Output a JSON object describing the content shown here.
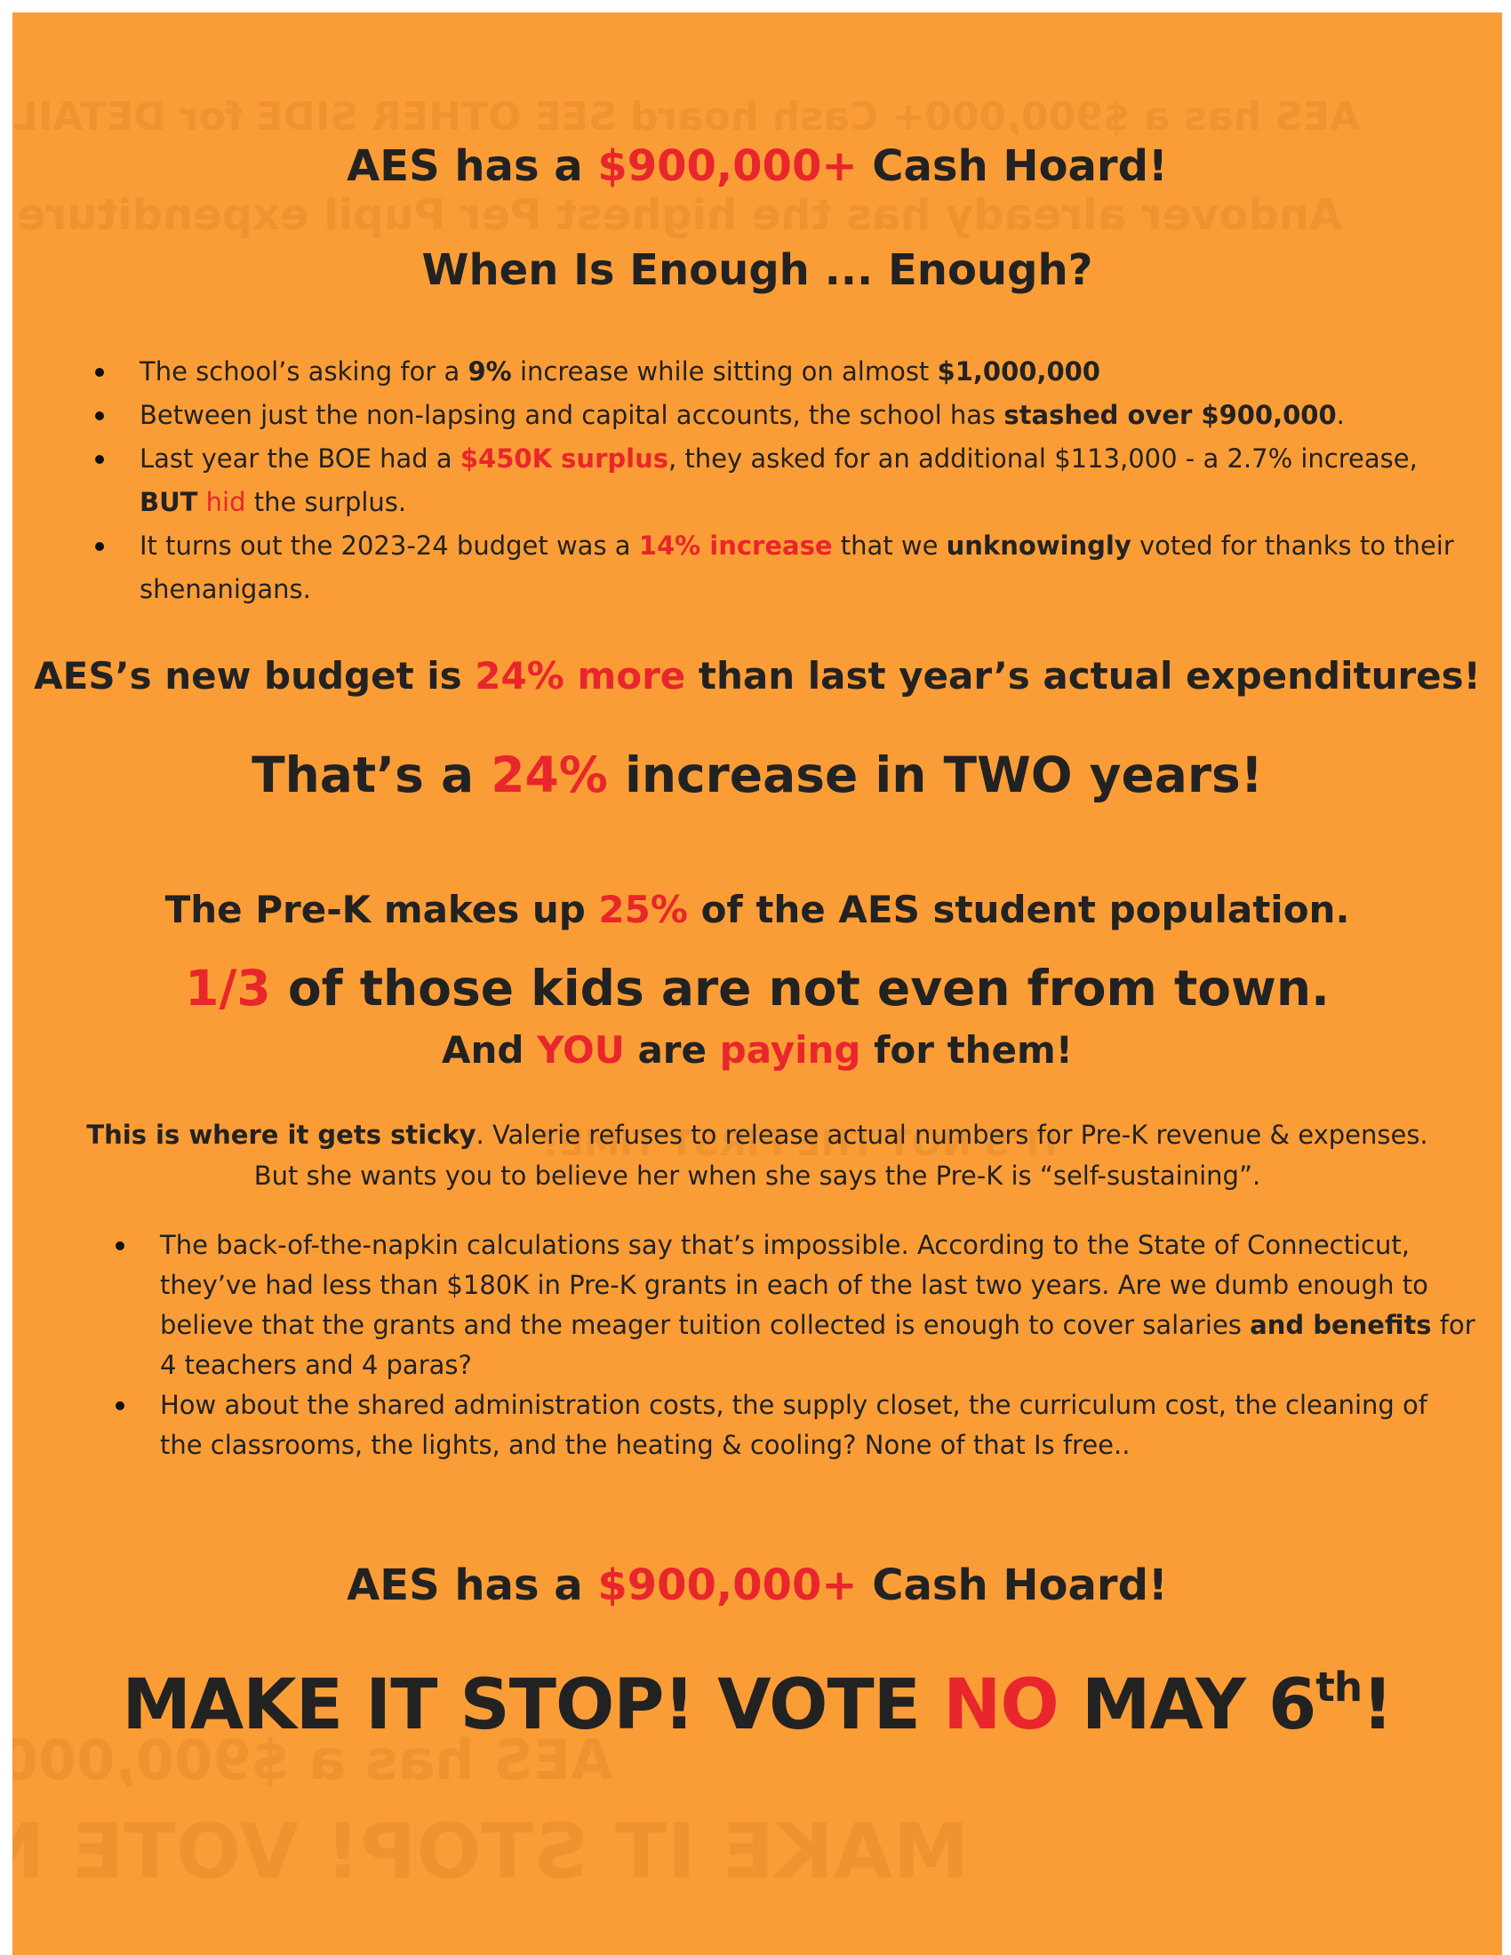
{
  "header": {
    "line1": {
      "a": "AES has a ",
      "b": "$900,000+",
      "c": " Cash Hoard!"
    },
    "line2": "When Is Enough ... Enough?"
  },
  "bullets1": [
    {
      "a": "The school’s asking for a ",
      "b": "9%",
      "c": " increase while sitting on almost ",
      "d": "$1,000,000"
    },
    {
      "a": "Between just the non-lapsing and capital accounts, the school has ",
      "b": "stashed over $900,000",
      "c": "."
    },
    {
      "a": "Last year the BOE had a ",
      "b": "$450K surplus",
      "c": ", they asked for an additional $113,000 - a 2.7% increase, ",
      "d": "BUT",
      "e": " hid",
      "f": " the surplus."
    },
    {
      "a": "It turns out the 2023-24 budget was a ",
      "b": "14% increase",
      "c": " that we ",
      "d": "unknowingly",
      "e": " voted for thanks to their shenanigans."
    }
  ],
  "budget": {
    "line1": {
      "a": "AES’s new budget is ",
      "b": "24% more",
      "c": " than last year’s actual expenditures!"
    },
    "line2": {
      "a": "That’s a ",
      "b": "24%",
      "c": " increase in TWO years!"
    }
  },
  "prek": {
    "line1": {
      "a": "The Pre-K makes up ",
      "b": "25%",
      "c": " of the AES student population."
    },
    "line2": {
      "a": "1/3",
      "b": " of those kids are not even from town."
    },
    "line3": {
      "a": "And ",
      "b": "YOU",
      "c": " are ",
      "d": "paying",
      "e": " for them!"
    }
  },
  "sticky": {
    "bold": "This is where it gets sticky",
    "rest": ". Valerie refuses to release actual numbers for Pre-K revenue & expenses.",
    "line2": "But she wants you to believe her when she says the Pre-K is “self-sustaining”."
  },
  "bullets2": [
    {
      "a": "The back-of-the-napkin calculations say that’s impossible. According to the State of Connecticut, they’ve had less than $180K in Pre-K grants in each of the last two years. Are we dumb enough to believe that the grants and the meager tuition collected is enough to cover salaries ",
      "b": "and benefits",
      "c": " for 4 teachers and 4 paras?"
    },
    {
      "a": "How about the shared administration costs, the supply closet, the curriculum cost, the cleaning of the classrooms, the lights, and the heating & cooling? None of that Is free.."
    }
  ],
  "footer": {
    "line1": {
      "a": "AES has a ",
      "b": "$900,000+",
      "c": " Cash Hoard!"
    },
    "line2": {
      "a": "MAKE IT STOP! VOTE ",
      "b": "NO",
      "c": " MAY 6",
      "sup": "th",
      "d": "!"
    }
  },
  "colors": {
    "paper": "#fb9d37",
    "accent": "#e8262b",
    "text": "#222222"
  }
}
